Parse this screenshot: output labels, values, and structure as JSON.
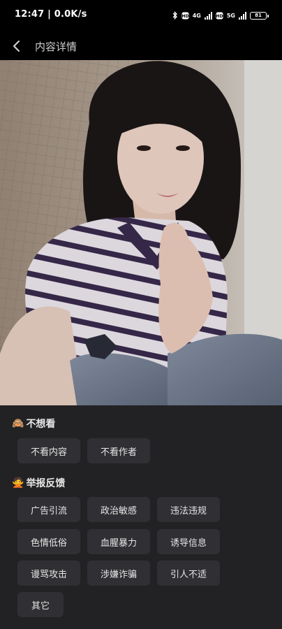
{
  "status_bar": {
    "time": "12:47 | 0.0K/s",
    "net_4g": "4G",
    "net_5g": "5G",
    "battery": "81",
    "icons": [
      "bluetooth-icon",
      "hd-icon",
      "signal-icon",
      "hd-icon",
      "signal-icon",
      "battery-icon"
    ]
  },
  "header": {
    "title": "内容详情",
    "back_icon": "chevron-left-icon"
  },
  "photo": {
    "description_icon": "photo"
  },
  "sheet": {
    "not_interested": {
      "emoji": "🙈",
      "title": "不想看",
      "options": [
        "不看内容",
        "不看作者"
      ]
    },
    "report": {
      "emoji": "🙅",
      "title": "举报反馈",
      "options": [
        "广告引流",
        "政治敏感",
        "违法违规",
        "色情低俗",
        "血腥暴力",
        "诱导信息",
        "谩骂攻击",
        "涉嫌诈骗",
        "引人不适",
        "其它"
      ]
    }
  },
  "colors": {
    "sheet_bg": "#222224",
    "chip_bg": "#303034",
    "text": "#e6e6e6"
  }
}
